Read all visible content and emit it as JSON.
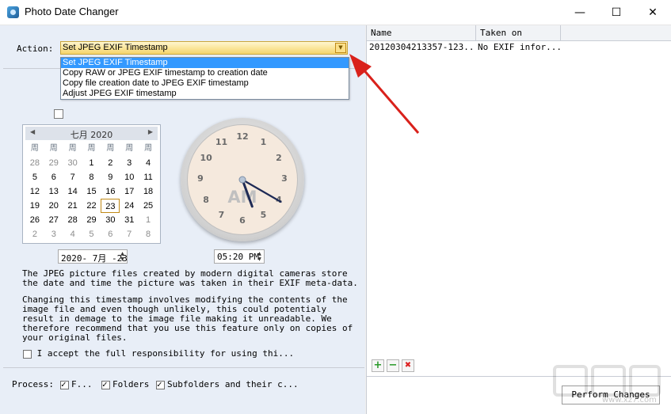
{
  "window": {
    "title": "Photo Date Changer",
    "minimize": "—",
    "maximize": "☐",
    "close": "✕"
  },
  "action": {
    "label": "Action:",
    "selected": "Set JPEG EXIF Timestamp",
    "options": [
      "Set JPEG EXIF Timestamp",
      "Copy RAW or JPEG EXIF timestamp to creation date",
      "Copy file creation date to JPEG EXIF timestamp",
      "Adjust JPEG EXIF timestamp"
    ]
  },
  "calendar": {
    "title": "七月 2020",
    "prev": "◀",
    "next": "▶",
    "weekday_headers": [
      "周",
      "周",
      "周",
      "周",
      "周",
      "周",
      "周"
    ],
    "weeks": [
      [
        "28",
        "29",
        "30",
        "1",
        "2",
        "3",
        "4"
      ],
      [
        "5",
        "6",
        "7",
        "8",
        "9",
        "10",
        "11"
      ],
      [
        "12",
        "13",
        "14",
        "15",
        "16",
        "17",
        "18"
      ],
      [
        "19",
        "20",
        "21",
        "22",
        "23",
        "24",
        "25"
      ],
      [
        "26",
        "27",
        "28",
        "29",
        "30",
        "31",
        "1"
      ],
      [
        "2",
        "3",
        "4",
        "5",
        "6",
        "7",
        "8"
      ]
    ],
    "selected_day": "23"
  },
  "clock": {
    "numbers": [
      "12",
      "1",
      "2",
      "3",
      "4",
      "5",
      "6",
      "7",
      "8",
      "9",
      "10",
      "11"
    ],
    "ampm": "AM",
    "hour": 5,
    "minute": 20
  },
  "date_value": "2020- 7月 -23",
  "time_value": "05:20 PM",
  "text": {
    "para1": "The JPEG picture files created by modern digital cameras store the date and time the picture was taken in their EXIF meta-data.",
    "para2": "Changing this timestamp involves modifying the contents of the image file and even though unlikely, this could potentialy result in demage to the image file making it unreadable. We therefore recommend that you use this feature only on copies of your original files.",
    "accept": "I accept the full responsibility for using thi..."
  },
  "process": {
    "label": "Process:",
    "files": "F...",
    "folders": "Folders",
    "subfolders": "Subfolders and their c..."
  },
  "list": {
    "columns": [
      "Name",
      "Taken on"
    ],
    "rows": [
      {
        "name": "20120304213357-123...",
        "taken": "No EXIF infor..."
      }
    ]
  },
  "toolbar": {
    "add": "+",
    "remove": "−",
    "clear": "✖"
  },
  "perform_label": "Perform Changes",
  "watermark": "www.xz7.com",
  "colors": {
    "accent_select": "#f6d56a",
    "selection": "#3399ff",
    "arrow": "#d9211b",
    "panel": "#e8eef7"
  }
}
